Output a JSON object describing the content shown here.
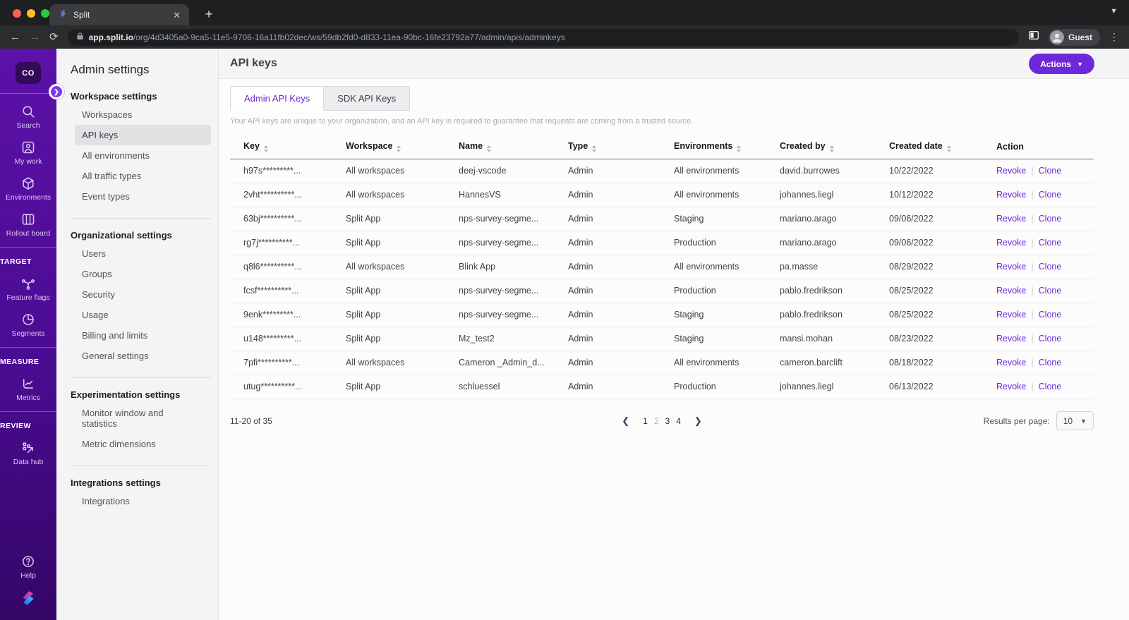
{
  "colors": {
    "accent": "#6d28d9",
    "rail_top": "#5c11a8",
    "rail_bottom": "#340667",
    "link": "#6d28d9",
    "active_nav_bg": "#e2e2e5"
  },
  "browser": {
    "tab_title": "Split",
    "url_host": "app.split.io",
    "url_path": "/org/4d3405a0-9ca5-11e5-9706-16a11fb02dec/ws/59db2fd0-d833-11ea-90bc-16fe23792a77/admin/apis/adminkeys",
    "profile_label": "Guest"
  },
  "sidebar": {
    "workspace_badge": "CO",
    "primary": [
      {
        "label": "Search",
        "icon": "search"
      },
      {
        "label": "My work",
        "icon": "my-work"
      },
      {
        "label": "Environments",
        "icon": "environments"
      },
      {
        "label": "Rollout board",
        "icon": "rollout-board"
      }
    ],
    "sections": [
      {
        "header": "TARGET",
        "items": [
          {
            "label": "Feature flags",
            "icon": "feature-flags"
          },
          {
            "label": "Segments",
            "icon": "segments"
          }
        ]
      },
      {
        "header": "MEASURE",
        "items": [
          {
            "label": "Metrics",
            "icon": "metrics"
          }
        ]
      },
      {
        "header": "REVIEW",
        "items": [
          {
            "label": "Data hub",
            "icon": "data-hub"
          }
        ]
      }
    ],
    "help_label": "Help"
  },
  "settings_nav": {
    "title": "Admin settings",
    "groups": [
      {
        "header": "Workspace settings",
        "items": [
          {
            "label": "Workspaces"
          },
          {
            "label": "API keys",
            "active": true
          },
          {
            "label": "All environments"
          },
          {
            "label": "All traffic types"
          },
          {
            "label": "Event types"
          }
        ]
      },
      {
        "header": "Organizational settings",
        "items": [
          {
            "label": "Users"
          },
          {
            "label": "Groups"
          },
          {
            "label": "Security"
          },
          {
            "label": "Usage"
          },
          {
            "label": "Billing and limits"
          },
          {
            "label": "General settings"
          }
        ]
      },
      {
        "header": "Experimentation settings",
        "items": [
          {
            "label": "Monitor window and statistics"
          },
          {
            "label": "Metric dimensions"
          }
        ]
      },
      {
        "header": "Integrations settings",
        "items": [
          {
            "label": "Integrations"
          }
        ]
      }
    ]
  },
  "main": {
    "title": "API keys",
    "actions_label": "Actions",
    "tabs": [
      {
        "label": "Admin API Keys",
        "active": true
      },
      {
        "label": "SDK API Keys",
        "active": false
      }
    ],
    "description": "Your API keys are unique to your organization, and an API key is required to guarantee that requests are coming from a trusted source.",
    "table": {
      "columns": [
        {
          "label": "Key",
          "sortable": true
        },
        {
          "label": "Workspace",
          "sortable": true
        },
        {
          "label": "Name",
          "sortable": true
        },
        {
          "label": "Type",
          "sortable": true
        },
        {
          "label": "Environments",
          "sortable": true
        },
        {
          "label": "Created by",
          "sortable": true
        },
        {
          "label": "Created date",
          "sortable": true
        },
        {
          "label": "Action",
          "sortable": false
        }
      ],
      "rows": [
        {
          "key": "h97s*********...",
          "workspace": "All workspaces",
          "name": "deej-vscode",
          "type": "Admin",
          "environments": "All environments",
          "created_by": "david.burrowes",
          "created_date": "10/22/2022",
          "actions": [
            "Revoke",
            "Clone"
          ]
        },
        {
          "key": "2vht**********...",
          "workspace": "All workspaces",
          "name": "HannesVS",
          "type": "Admin",
          "environments": "All environments",
          "created_by": "johannes.liegl",
          "created_date": "10/12/2022",
          "actions": [
            "Revoke",
            "Clone"
          ]
        },
        {
          "key": "63bj**********...",
          "workspace": "Split App",
          "name": "nps-survey-segme...",
          "type": "Admin",
          "environments": "Staging",
          "created_by": "mariano.arago",
          "created_date": "09/06/2022",
          "actions": [
            "Revoke",
            "Clone"
          ]
        },
        {
          "key": "rg7j**********...",
          "workspace": "Split App",
          "name": "nps-survey-segme...",
          "type": "Admin",
          "environments": "Production",
          "created_by": "mariano.arago",
          "created_date": "09/06/2022",
          "actions": [
            "Revoke",
            "Clone"
          ]
        },
        {
          "key": "q8l6**********...",
          "workspace": "All workspaces",
          "name": "Blink App",
          "type": "Admin",
          "environments": "All environments",
          "created_by": "pa.masse",
          "created_date": "08/29/2022",
          "actions": [
            "Revoke",
            "Clone"
          ]
        },
        {
          "key": "fcsf**********...",
          "workspace": "Split App",
          "name": "nps-survey-segme...",
          "type": "Admin",
          "environments": "Production",
          "created_by": "pablo.fredrikson",
          "created_date": "08/25/2022",
          "actions": [
            "Revoke",
            "Clone"
          ]
        },
        {
          "key": "9enk*********...",
          "workspace": "Split App",
          "name": "nps-survey-segme...",
          "type": "Admin",
          "environments": "Staging",
          "created_by": "pablo.fredrikson",
          "created_date": "08/25/2022",
          "actions": [
            "Revoke",
            "Clone"
          ]
        },
        {
          "key": "u148*********...",
          "workspace": "Split App",
          "name": "Mz_test2",
          "type": "Admin",
          "environments": "Staging",
          "created_by": "mansi.mohan",
          "created_date": "08/23/2022",
          "actions": [
            "Revoke",
            "Clone"
          ]
        },
        {
          "key": "7pfi**********...",
          "workspace": "All workspaces",
          "name": "Cameron _Admin_d...",
          "type": "Admin",
          "environments": "All environments",
          "created_by": "cameron.barclift",
          "created_date": "08/18/2022",
          "actions": [
            "Revoke",
            "Clone"
          ]
        },
        {
          "key": "utug**********...",
          "workspace": "Split App",
          "name": "schluessel",
          "type": "Admin",
          "environments": "Production",
          "created_by": "johannes.liegl",
          "created_date": "06/13/2022",
          "actions": [
            "Revoke",
            "Clone"
          ]
        }
      ]
    },
    "pagination": {
      "range_label": "11-20 of 35",
      "pages": [
        "1",
        "2",
        "3",
        "4"
      ],
      "current_page": "2",
      "results_per_page_label": "Results per page:",
      "results_per_page_value": "10"
    }
  }
}
